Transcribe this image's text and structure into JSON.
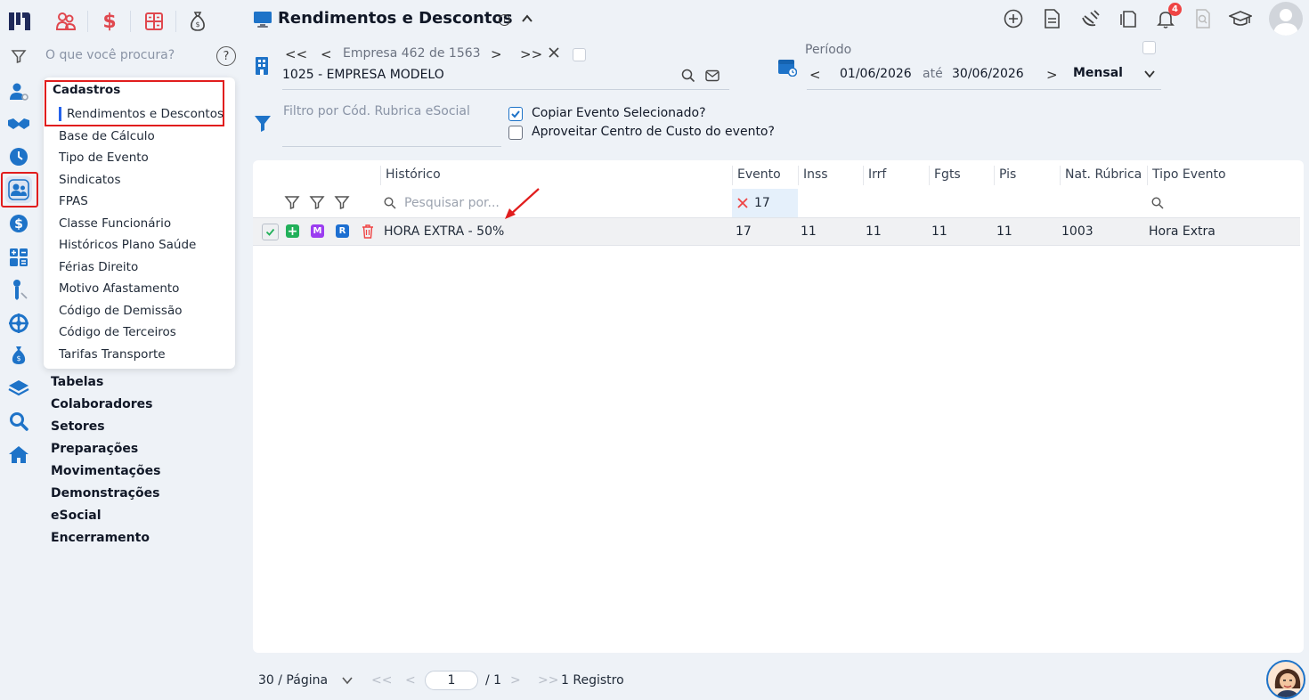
{
  "app": {
    "title": "Rendimentos e Descontos",
    "notifications_count": "4"
  },
  "sidebar": {
    "search_placeholder": "O que você procura?",
    "submenu": {
      "title": "Cadastros",
      "items": [
        "Rendimentos e Descontos",
        "Base de Cálculo",
        "Tipo de Evento",
        "Sindicatos",
        "FPAS",
        "Classe Funcionário",
        "Históricos Plano Saúde",
        "Férias Direito",
        "Motivo Afastamento",
        "Código de Demissão",
        "Código de Terceiros",
        "Tarifas Transporte"
      ]
    },
    "groups": [
      "Tabelas",
      "Colaboradores",
      "Setores",
      "Preparações",
      "Movimentações",
      "Demonstrações",
      "eSocial",
      "Encerramento"
    ]
  },
  "empresa": {
    "label": "Empresa",
    "current": "462",
    "of": "de",
    "total": "1563",
    "name": "1025 - EMPRESA MODELO"
  },
  "periodo": {
    "label": "Período",
    "start": "01/06/2026",
    "separator": "até",
    "end": "30/06/2026",
    "frequency": "Mensal"
  },
  "filters": {
    "rubrica_placeholder": "Filtro por Cód. Rubrica eSocial",
    "copy_event_label": "Copiar Evento Selecionado?",
    "copy_event_checked": true,
    "cost_center_label": "Aproveitar Centro de Custo do evento?",
    "cost_center_checked": false
  },
  "grid": {
    "columns": [
      "Histórico",
      "Evento",
      "Inss",
      "Irrf",
      "Fgts",
      "Pis",
      "Nat. Rúbrica",
      "Tipo Evento"
    ],
    "historico_search_placeholder": "Pesquisar por...",
    "evento_filter_value": "17",
    "row_badges": {
      "m": "M",
      "r": "R"
    },
    "rows": [
      {
        "historico": "HORA EXTRA - 50%",
        "evento": "17",
        "inss": "11",
        "irrf": "11",
        "fgts": "11",
        "pis": "11",
        "nat_rubrica": "1003",
        "tipo_evento": "Hora Extra"
      }
    ]
  },
  "pagination": {
    "page_size": "30 / Página",
    "current_page": "1",
    "total_pages": "/ 1",
    "records": "1 Registro"
  },
  "colors": {
    "accent_blue": "#1e73c8",
    "highlight_red": "#e11d1d",
    "badge_green": "#22b05a",
    "badge_purple": "#9b3df0",
    "badge_blue": "#1d6fd1"
  }
}
